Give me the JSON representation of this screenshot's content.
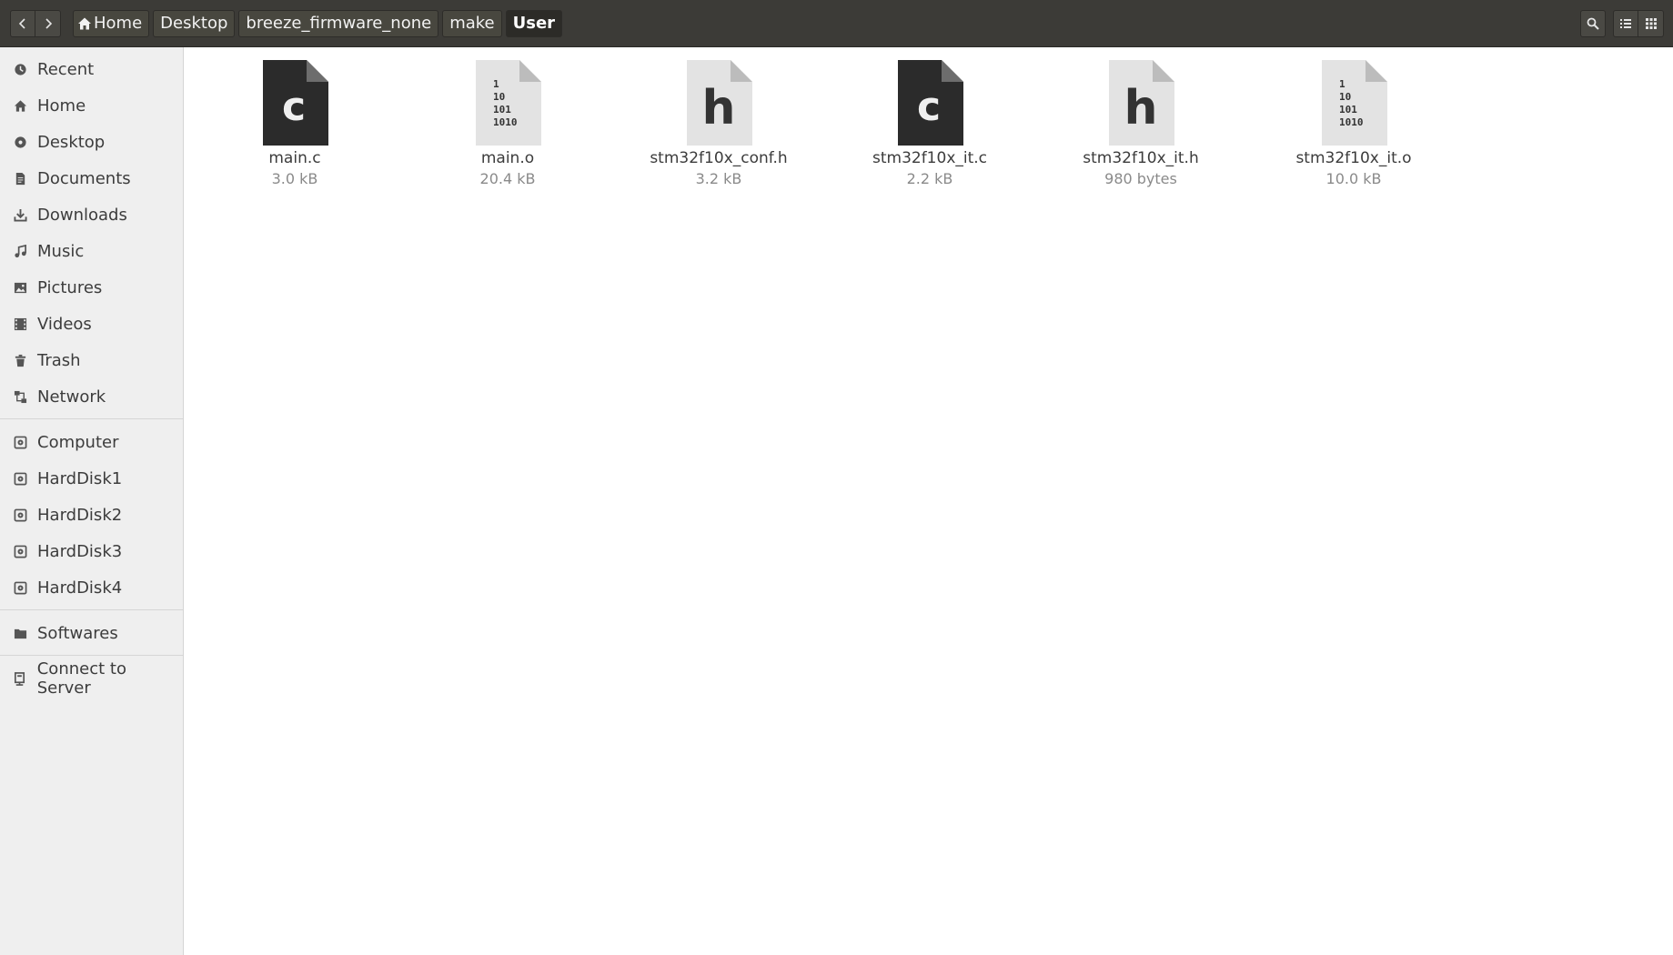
{
  "header": {
    "back_icon": "chevron-left-icon",
    "forward_icon": "chevron-right-icon",
    "breadcrumbs": [
      {
        "label": "Home",
        "icon": "home-icon"
      },
      {
        "label": "Desktop"
      },
      {
        "label": "breeze_firmware_none"
      },
      {
        "label": "make"
      },
      {
        "label": "User"
      }
    ],
    "search_icon": "search-icon",
    "list_view_icon": "list-view-icon",
    "grid_view_icon": "grid-view-icon"
  },
  "sidebar": {
    "places": [
      {
        "label": "Recent",
        "icon": "clock-icon"
      },
      {
        "label": "Home",
        "icon": "home-icon"
      },
      {
        "label": "Desktop",
        "icon": "desktop-icon"
      },
      {
        "label": "Documents",
        "icon": "document-icon"
      },
      {
        "label": "Downloads",
        "icon": "download-icon"
      },
      {
        "label": "Music",
        "icon": "music-icon"
      },
      {
        "label": "Pictures",
        "icon": "picture-icon"
      },
      {
        "label": "Videos",
        "icon": "video-icon"
      },
      {
        "label": "Trash",
        "icon": "trash-icon"
      },
      {
        "label": "Network",
        "icon": "network-icon"
      }
    ],
    "devices": [
      {
        "label": "Computer",
        "icon": "drive-icon"
      },
      {
        "label": "HardDisk1",
        "icon": "drive-icon"
      },
      {
        "label": "HardDisk2",
        "icon": "drive-icon"
      },
      {
        "label": "HardDisk3",
        "icon": "drive-icon"
      },
      {
        "label": "HardDisk4",
        "icon": "drive-icon"
      }
    ],
    "bookmarks": [
      {
        "label": "Softwares",
        "icon": "folder-icon"
      }
    ],
    "other": [
      {
        "label": "Connect to Server",
        "icon": "server-icon"
      }
    ]
  },
  "files": [
    {
      "name": "main.c",
      "size": "3.0 kB",
      "icon": "c-source-file-icon",
      "letter": "c"
    },
    {
      "name": "main.o",
      "size": "20.4 kB",
      "icon": "binary-file-icon",
      "letter": ""
    },
    {
      "name": "stm32f10x_conf.h",
      "size": "3.2 kB",
      "icon": "header-file-icon",
      "letter": "h"
    },
    {
      "name": "stm32f10x_it.c",
      "size": "2.2 kB",
      "icon": "c-source-file-icon",
      "letter": "c"
    },
    {
      "name": "stm32f10x_it.h",
      "size": "980 bytes",
      "icon": "header-file-icon",
      "letter": "h"
    },
    {
      "name": "stm32f10x_it.o",
      "size": "10.0 kB",
      "icon": "binary-file-icon",
      "letter": ""
    }
  ],
  "binary_glyph_lines": [
    "1",
    "10",
    "101",
    "1010"
  ]
}
